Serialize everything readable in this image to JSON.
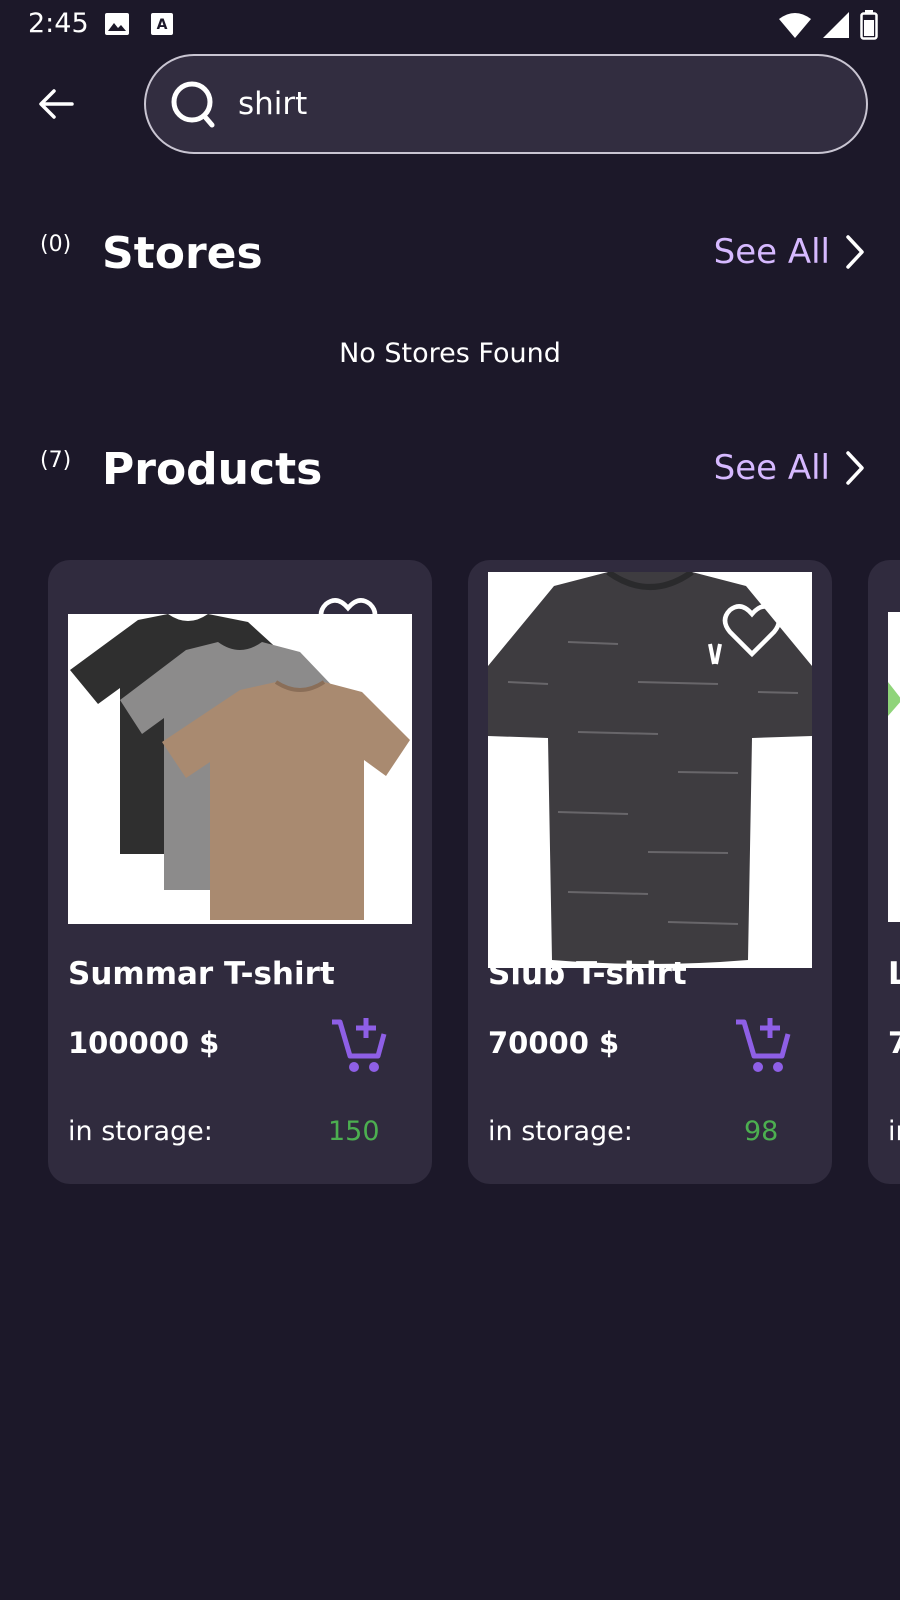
{
  "status_bar": {
    "time": "2:45",
    "icons": [
      "image-icon",
      "a-icon",
      "wifi-icon",
      "signal-icon",
      "battery-icon"
    ]
  },
  "search": {
    "value": "shirt",
    "back_icon": "arrow-left-icon",
    "search_icon": "search-icon"
  },
  "stores": {
    "count": "(0)",
    "title": "Stores",
    "see_all": "See All",
    "empty_message": "No Stores Found"
  },
  "products": {
    "count": "(7)",
    "title": "Products",
    "see_all": "See All",
    "storage_label": "in storage:",
    "items": [
      {
        "name": "Summar T-shirt",
        "price": "100000 $",
        "stock": "150"
      },
      {
        "name": "Slub T-shirt",
        "price": "70000 $",
        "stock": "98"
      },
      {
        "name": "L",
        "price": "7",
        "stock": ""
      }
    ]
  },
  "colors": {
    "background": "#1c1829",
    "card": "#302b3e",
    "accent": "#d6b9ff",
    "cart": "#8e5fe6",
    "stock": "#4caf50"
  }
}
